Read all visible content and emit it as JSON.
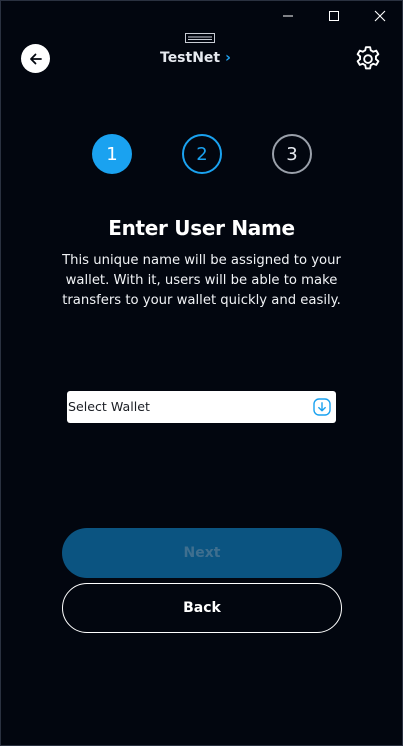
{
  "window": {
    "minimize_icon": "minimize-icon",
    "maximize_icon": "maximize-icon",
    "close_icon": "close-icon"
  },
  "header": {
    "network_label": "TestNet",
    "network_chevron": "›",
    "back_icon": "arrow-left-icon",
    "settings_icon": "gear-icon"
  },
  "steps": [
    {
      "number": "1",
      "state": "active"
    },
    {
      "number": "2",
      "state": "upcoming-highlight"
    },
    {
      "number": "3",
      "state": "upcoming"
    }
  ],
  "content": {
    "title": "Enter User Name",
    "description": "This unique name will be assigned to your wallet. With it, users will be able to make transfers to your wallet quickly and easily."
  },
  "wallet_select": {
    "selected": "Select Wallet",
    "icon": "chevron-down-circle-icon"
  },
  "buttons": {
    "next_label": "Next",
    "back_label": "Back"
  },
  "colors": {
    "background": "#02060f",
    "accent": "#1aa2f0",
    "next_disabled_bg": "#0b5481",
    "next_disabled_text": "#3f6f8f"
  }
}
